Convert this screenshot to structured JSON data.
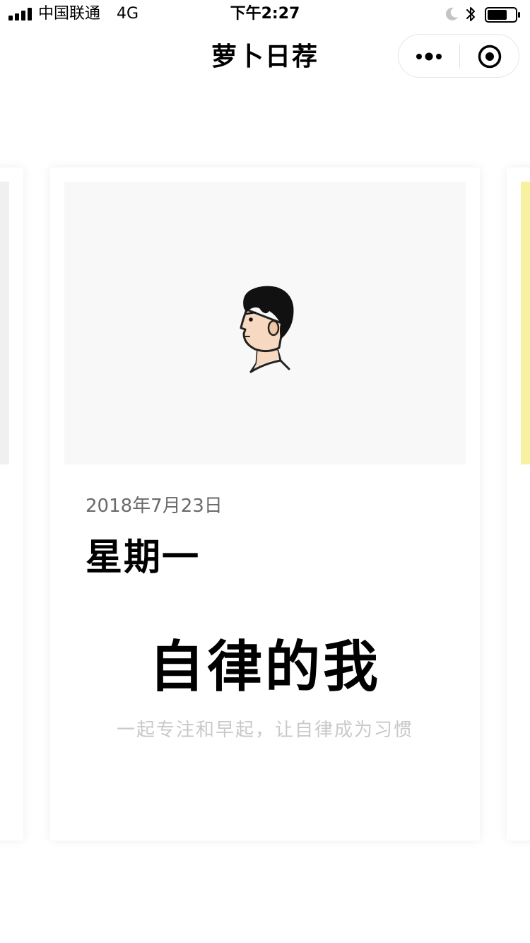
{
  "status_bar": {
    "carrier": "中国联通",
    "network": "4G",
    "time": "下午2:27",
    "icons": [
      "signal-icon",
      "moon-icon",
      "bluetooth-icon",
      "battery-icon"
    ]
  },
  "nav": {
    "title": "萝卜日荐",
    "icons": [
      "more-icon",
      "close-mini-program-icon"
    ]
  },
  "cards": {
    "current": {
      "image": "avatar-illustration",
      "date": "2018年7月23日",
      "weekday": "星期一",
      "heading": "自律的我",
      "subtitle": "一起专注和早起，让自律成为习惯"
    }
  },
  "colors": {
    "background": "#ffffff",
    "cover_background": "#f8f8f8",
    "next_card_accent": "#f7f2a0",
    "date_text": "#6a6a6a",
    "subtitle_text": "#c9c9c9"
  }
}
